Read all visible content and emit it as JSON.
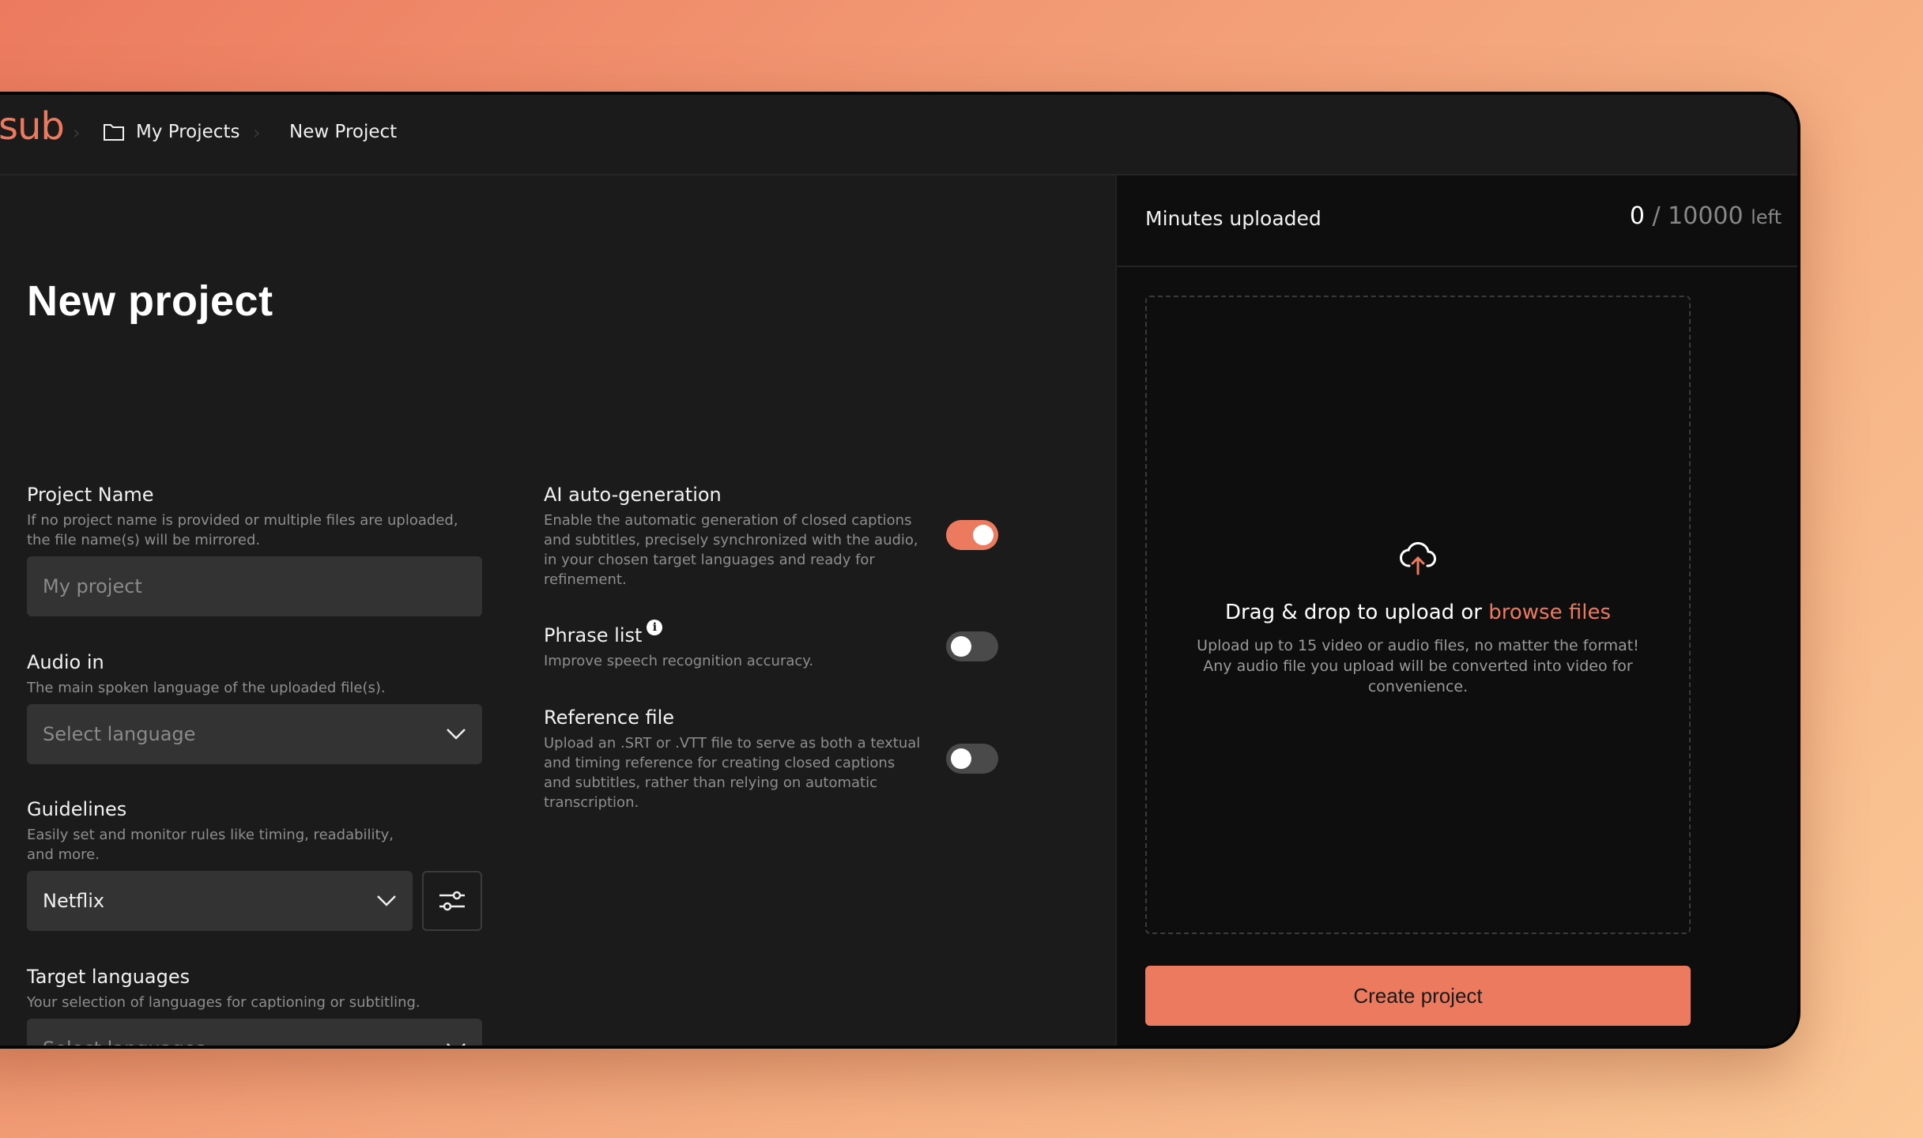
{
  "header": {
    "logo": "sub",
    "breadcrumb": [
      {
        "label": "My Projects",
        "icon": "folder-icon"
      },
      {
        "label": "New Project"
      }
    ],
    "separator": "›"
  },
  "page": {
    "title": "New project"
  },
  "form": {
    "project_name": {
      "label": "Project Name",
      "description": "If no project name is provided or multiple files are uploaded, the file name(s) will be mirrored.",
      "placeholder": "My project",
      "value": ""
    },
    "audio_in": {
      "label": "Audio in",
      "description": "The main spoken language of the uploaded file(s).",
      "placeholder": "Select language"
    },
    "guidelines": {
      "label": "Guidelines",
      "description": "Easily set and monitor rules like timing, readability, and more.",
      "value": "Netflix"
    },
    "target_languages": {
      "label": "Target languages",
      "description": "Your selection of languages for captioning or subtitling.",
      "placeholder": "Select languages"
    }
  },
  "options": [
    {
      "label": "AI auto-generation",
      "description": "Enable the automatic generation of closed captions and subtitles, precisely synchronized with the audio, in your chosen target languages and ready for refinement.",
      "enabled": true
    },
    {
      "label": "Phrase list",
      "description": "Improve speech recognition accuracy.",
      "enabled": false,
      "info_icon": "i"
    },
    {
      "label": "Reference file",
      "description": "Upload an .SRT or .VTT file to serve as both a textual and timing reference for creating closed captions and subtitles, rather than relying on automatic transcription.",
      "enabled": false
    }
  ],
  "sidebar": {
    "minutes_label": "Minutes uploaded",
    "minutes_used": "0",
    "minutes_separator": "/",
    "minutes_total": "10000",
    "minutes_suffix": "left",
    "dropzone": {
      "title_prefix": "Drag & drop to upload or",
      "browse_label": "browse files",
      "description": "Upload up to 15 video or audio files, no matter the format! Any audio file you upload will be converted into video for convenience."
    },
    "create_label": "Create project"
  },
  "colors": {
    "accent": "#ec7a5e",
    "panel": "#1b1b1b",
    "sidebar": "#0e0e0e",
    "input": "#333333"
  }
}
